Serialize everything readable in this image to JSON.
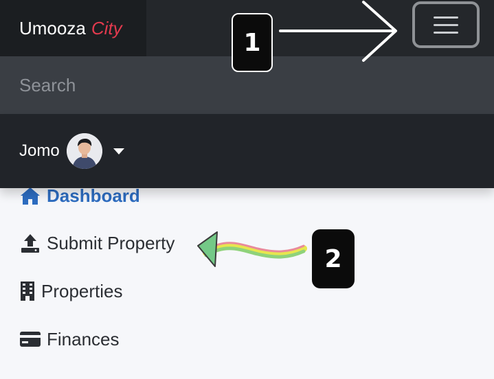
{
  "navbar": {
    "brand_main": "Umooza",
    "brand_accent": "City",
    "toggler_icon": "hamburger-icon"
  },
  "search": {
    "placeholder": "Search",
    "value": ""
  },
  "user": {
    "name": "Jomo",
    "avatar_icon": "user-avatar",
    "caret_icon": "caret-down-icon"
  },
  "menu": {
    "items": [
      {
        "label": "Dashboard",
        "icon": "home-icon",
        "active": true
      },
      {
        "label": "Submit Property",
        "icon": "upload-icon",
        "active": false
      },
      {
        "label": "Properties",
        "icon": "building-icon",
        "active": false
      },
      {
        "label": "Finances",
        "icon": "credit-card-icon",
        "active": false
      }
    ]
  },
  "annotations": {
    "step1": "1",
    "step2": "2"
  },
  "colors": {
    "navbar_bg": "#24272b",
    "brand_bg": "#1b1e21",
    "brand_accent": "#e23a4e",
    "search_bg": "#3a3e44",
    "user_bg": "#212429",
    "active_link": "#2d6cc0",
    "page_bg": "#f6f7fa"
  }
}
